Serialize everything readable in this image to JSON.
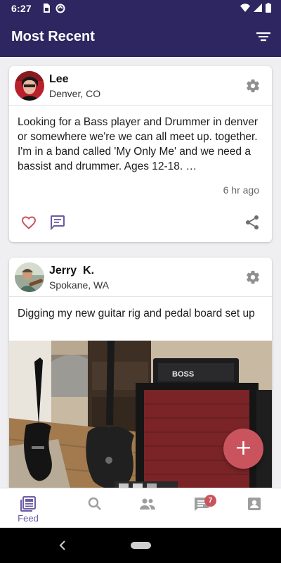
{
  "status_bar": {
    "time": "6:27",
    "icons": [
      "sim-card-icon",
      "sync-icon",
      "wifi-icon",
      "signal-icon",
      "battery-icon"
    ]
  },
  "app_bar": {
    "title": "Most Recent",
    "filter_icon": "filter-icon"
  },
  "colors": {
    "primary": "#2e2660",
    "accent": "#c9545e",
    "nav_active": "#6b5ca5",
    "nav_inactive": "#9e9e9e"
  },
  "posts": [
    {
      "author": "Lee",
      "location": "Denver, CO",
      "text": "Looking for a Bass player and Drummer in denver or somewhere we're we can all meet up. together. I'm in a band called 'My Only Me' and we need a bassist and drummer. Ages 12-18. …",
      "time": "6 hr ago",
      "actions": [
        "heart-icon",
        "comment-icon",
        "share-icon"
      ]
    },
    {
      "author": "Jerry  K.",
      "location": "Spokane, WA",
      "text": "Digging my new guitar rig and pedal board set up",
      "photo_label": "BOSS"
    }
  ],
  "fab": {
    "label": "+"
  },
  "bottom_nav": {
    "items": [
      {
        "icon": "feed-icon",
        "label": "Feed",
        "active": true
      },
      {
        "icon": "search-icon"
      },
      {
        "icon": "people-icon"
      },
      {
        "icon": "messages-icon",
        "badge": "7"
      },
      {
        "icon": "profile-icon"
      }
    ]
  }
}
